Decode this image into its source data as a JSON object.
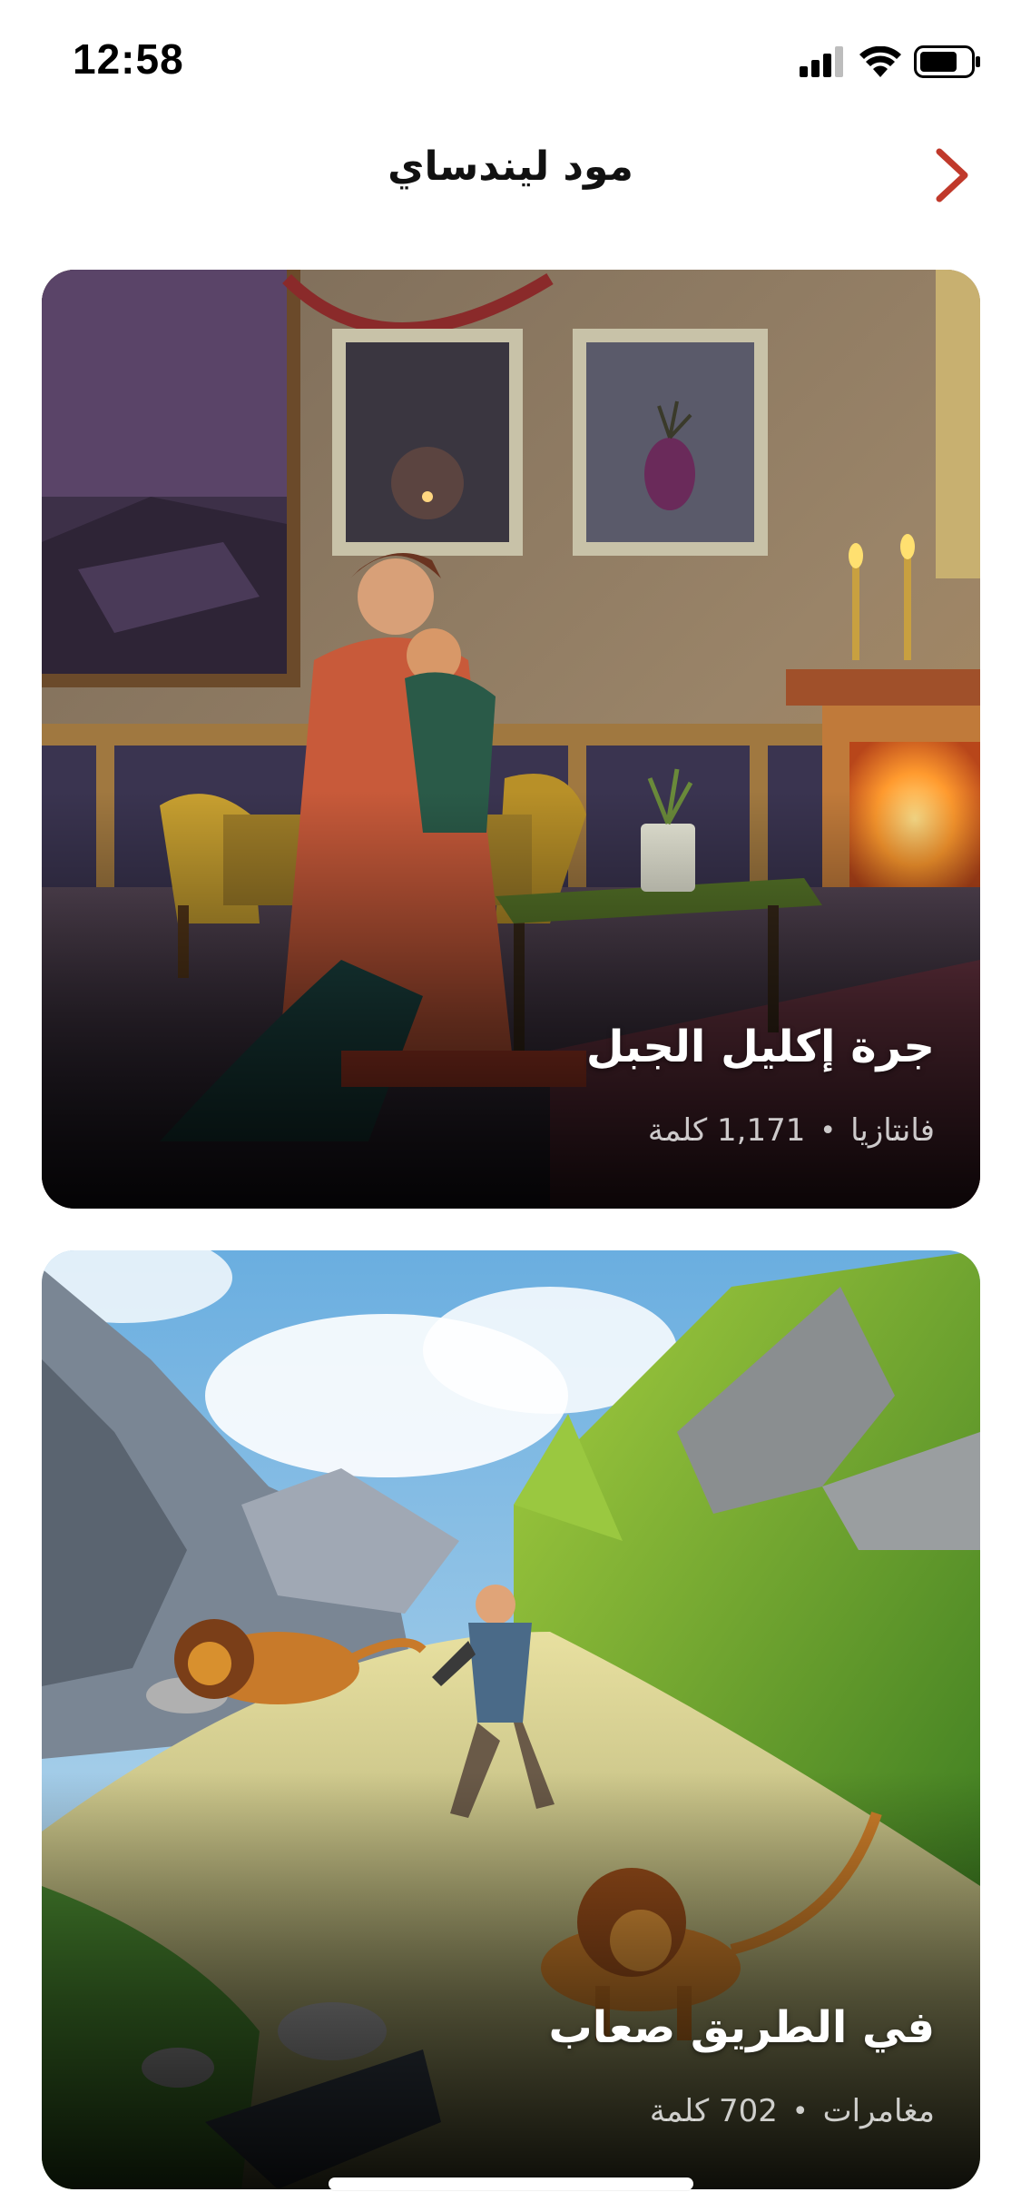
{
  "status_bar": {
    "time": "12:58",
    "icons": [
      "cellular-signal-icon",
      "wifi-icon",
      "battery-icon"
    ]
  },
  "header": {
    "title": "مود ليندساي",
    "back_icon": "chevron-right-icon",
    "accent_color": "#c0392b"
  },
  "stories": [
    {
      "title": "جرة إكليل الجبل",
      "genre": "فانتازيا",
      "separator": "•",
      "word_count": "1,171 كلمة"
    },
    {
      "title": "في الطريق صعاب",
      "genre": "مغامرات",
      "separator": "•",
      "word_count": "702 كلمة"
    }
  ]
}
